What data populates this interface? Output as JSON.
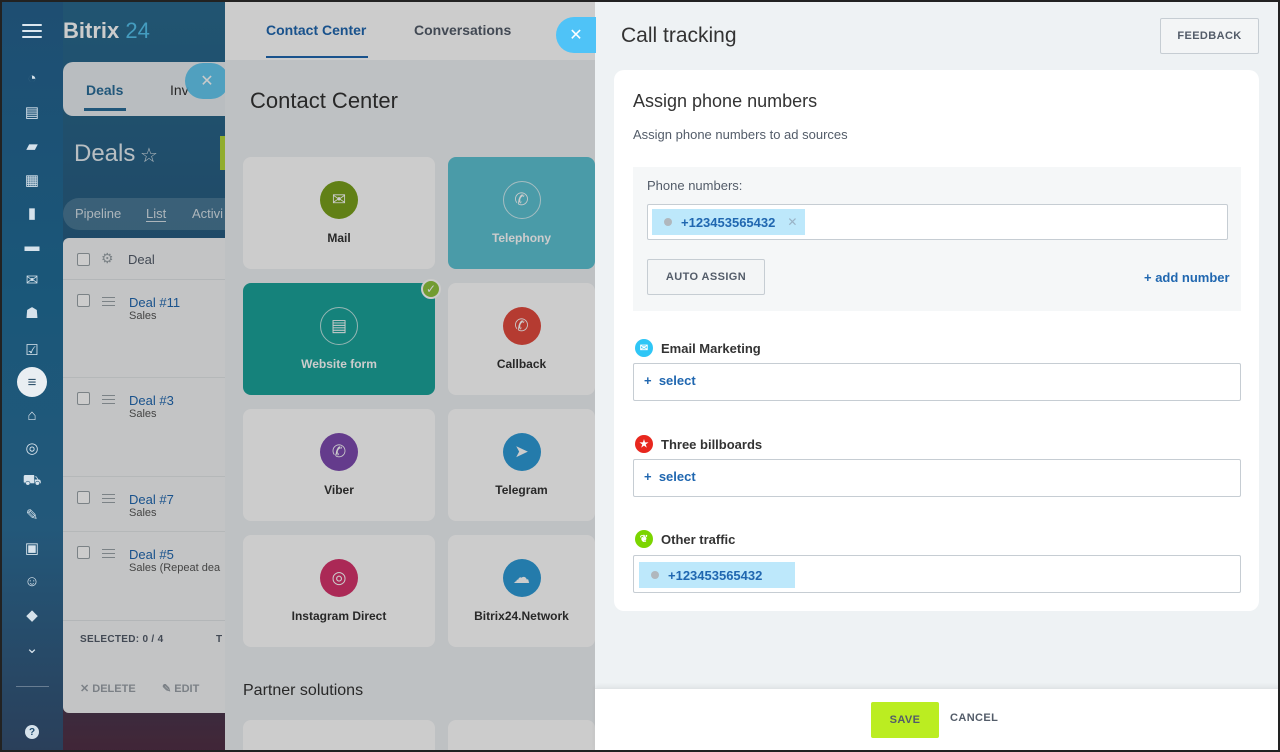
{
  "app": {
    "logo_name": "Bitrix",
    "logo_num": "24"
  },
  "sidebar": {
    "icons": [
      "activity-icon",
      "feed-icon",
      "chat-icon",
      "calendar-icon",
      "document-icon",
      "drive-icon",
      "mail-icon",
      "team-icon",
      "tasks-icon",
      "crm-icon",
      "sites-icon",
      "target-icon",
      "cart-icon",
      "sign-icon",
      "contacts-icon",
      "robot-icon",
      "box-icon",
      "more-icon"
    ]
  },
  "deals": {
    "tab_active": "Deals",
    "tab_next": "Inv",
    "title": "Deals",
    "views": [
      "Pipeline",
      "List",
      "Activi"
    ],
    "column_header": "Deal",
    "rows": [
      {
        "name": "Deal #11",
        "stage": "Sales"
      },
      {
        "name": "Deal #3",
        "stage": "Sales"
      },
      {
        "name": "Deal #7",
        "stage": "Sales"
      },
      {
        "name": "Deal #5",
        "stage": "Sales (Repeat dea"
      }
    ],
    "selected_label": "SELECTED:",
    "selected_value": "0 / 4",
    "total_label": "T",
    "delete_label": "DELETE",
    "edit_label": "EDIT"
  },
  "contact_center": {
    "tabs": [
      "Contact Center",
      "Conversations"
    ],
    "title": "Contact Center",
    "tiles": [
      {
        "label": "Mail",
        "icon": "mail-icon",
        "color": "#7aa11c"
      },
      {
        "label": "Telephony",
        "icon": "phone-icon",
        "color": "#5dc2d3"
      },
      {
        "label": "Website form",
        "icon": "form-icon",
        "color": "#1ba39a"
      },
      {
        "label": "Callback",
        "icon": "callback-icon",
        "color": "#e34a3e"
      },
      {
        "label": "Viber",
        "icon": "viber-icon",
        "color": "#7d4ab0"
      },
      {
        "label": "Telegram",
        "icon": "telegram-icon",
        "color": "#2e9ad6"
      },
      {
        "label": "Instagram Direct",
        "icon": "instagram-icon",
        "color": "#d6346c"
      },
      {
        "label": "Bitrix24.Network",
        "icon": "cloud-icon",
        "color": "#2e9ad6"
      }
    ],
    "partner_title": "Partner solutions"
  },
  "call_tracking": {
    "title": "Call tracking",
    "feedback_label": "FEEDBACK",
    "section_title": "Assign phone numbers",
    "section_subtitle": "Assign phone numbers to ad sources",
    "phone_numbers_label": "Phone numbers:",
    "phone_chip": "+123453565432",
    "auto_assign_label": "AUTO ASSIGN",
    "add_number_label": "+ add number",
    "sources": [
      {
        "name": "Email Marketing",
        "icon": "email-marketing-icon",
        "color": "#2fc6f6",
        "select_label": "select"
      },
      {
        "name": "Three billboards",
        "icon": "billboard-icon",
        "color": "#e8271e",
        "select_label": "select"
      },
      {
        "name": "Other traffic",
        "icon": "other-traffic-icon",
        "color": "#7bd500",
        "assigned": "+123453565432"
      }
    ],
    "save_label": "SAVE",
    "cancel_label": "CANCEL"
  },
  "colors": {
    "accent": "#2067b0",
    "save": "#bbed21",
    "chip": "#bde8fb"
  }
}
